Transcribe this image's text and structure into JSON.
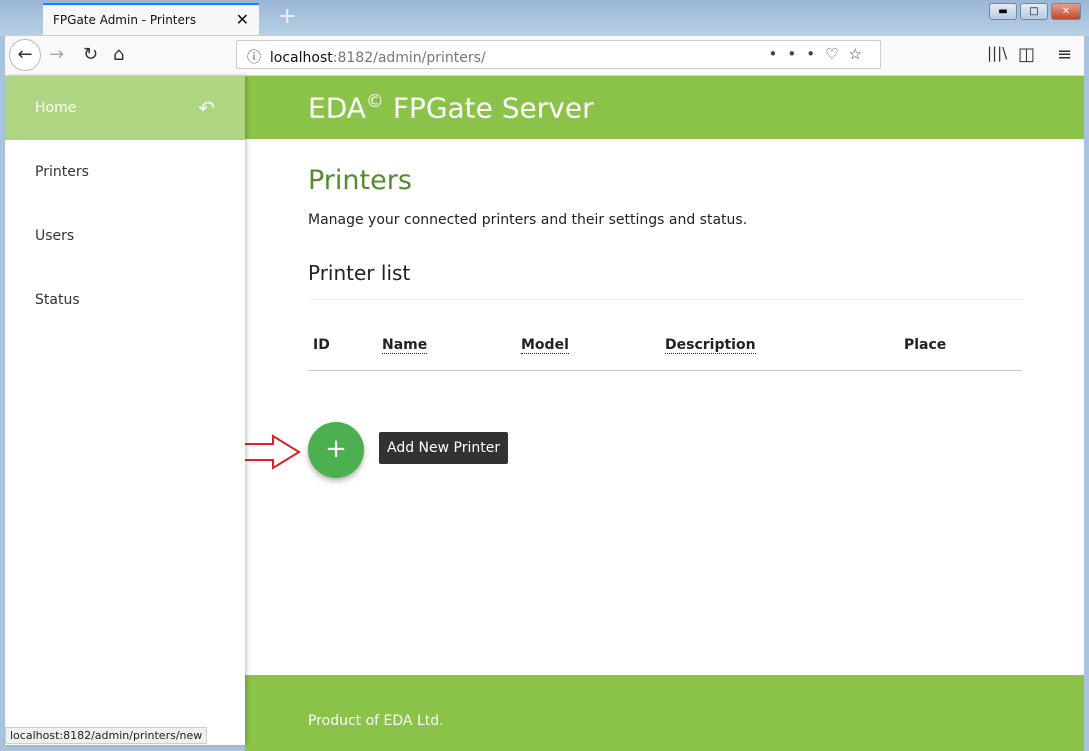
{
  "browser": {
    "tab_title": "FPGate Admin - Printers",
    "url_host": "localhost",
    "url_path": ":8182/admin/printers/",
    "status_url": "localhost:8182/admin/printers/new"
  },
  "sidebar": {
    "items": [
      {
        "label": "Home"
      },
      {
        "label": "Printers"
      },
      {
        "label": "Users"
      },
      {
        "label": "Status"
      }
    ]
  },
  "header": {
    "title_pre": "EDA",
    "title_sup": "©",
    "title_post": " FPGate Server"
  },
  "page": {
    "title": "Printers",
    "description": "Manage your connected printers and their settings and status.",
    "section": "Printer list"
  },
  "table": {
    "columns": [
      "ID",
      "Name",
      "Model",
      "Description",
      "Place"
    ],
    "rows": []
  },
  "actions": {
    "add_tooltip": "Add New Printer",
    "fab_symbol": "+"
  },
  "footer": {
    "text": "Product of EDA Ltd."
  },
  "colors": {
    "primary": "#8bc34a",
    "primary_light": "#aed581",
    "fab": "#4caf50",
    "title": "#558b2f"
  }
}
